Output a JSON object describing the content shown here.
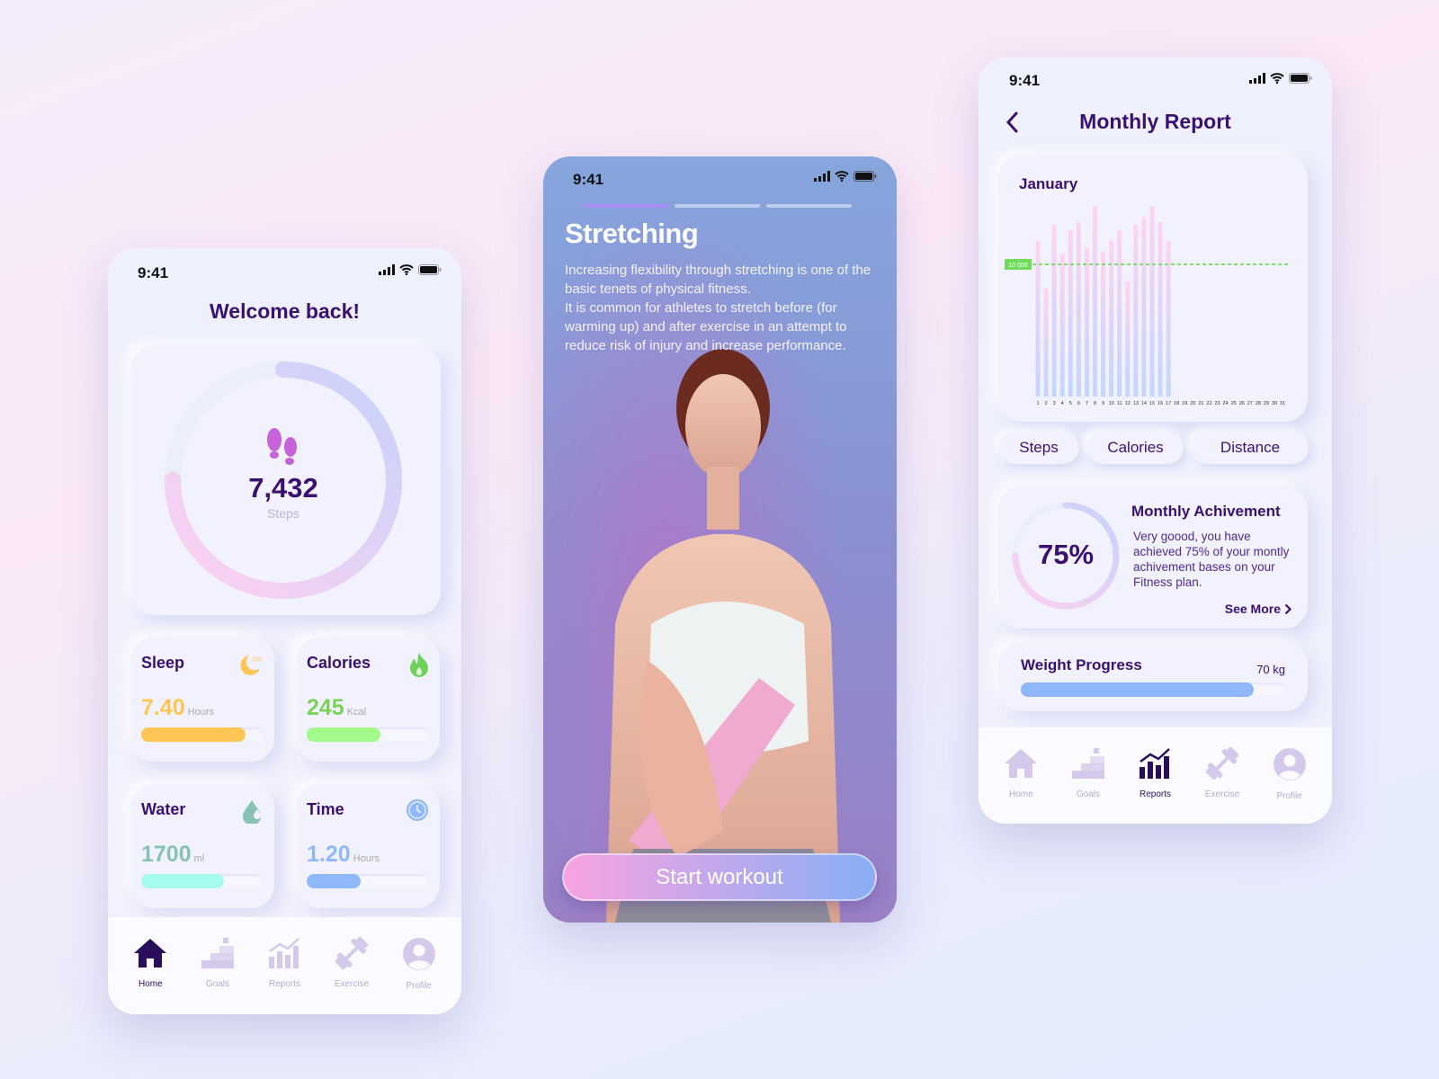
{
  "home": {
    "time": "9:41",
    "title": "Welcome back!",
    "steps": {
      "value": "7,432",
      "label": "Steps",
      "progress": 0.75
    },
    "tiles": [
      {
        "title": "Sleep",
        "value": "7.40",
        "unit": "Hours",
        "progress": 0.85,
        "color": "#ffc655",
        "icon": "moon-sleep-icon"
      },
      {
        "title": "Calories",
        "value": "245",
        "unit": "Kcal",
        "progress": 0.6,
        "color": "#a3f98a",
        "valueColor": "#7ad25a",
        "icon": "flame-icon"
      },
      {
        "title": "Water",
        "value": "1700",
        "unit": "ml",
        "progress": 0.68,
        "color": "#a6fbef",
        "valueColor": "#86c3b4",
        "icon": "water-drop-icon"
      },
      {
        "title": "Time",
        "value": "1.20",
        "unit": "Hours",
        "progress": 0.44,
        "color": "#8fb8fb",
        "valueColor": "#8fb8fb",
        "icon": "clock-icon"
      }
    ],
    "nav": [
      "Home",
      "Goals",
      "Reports",
      "Exercise",
      "Profile"
    ],
    "active_nav": "Home"
  },
  "workout": {
    "time": "9:41",
    "title": "Stretching",
    "steps_total": 3,
    "step_current": 1,
    "paragraphs": [
      "Increasing flexibility through stretching is one of the basic tenets of physical fitness.",
      "It is common for athletes to stretch before (for warming up) and after exercise in an attempt to reduce risk of injury and increase performance."
    ],
    "start_button": "Start workout"
  },
  "report": {
    "time": "9:41",
    "title": "Monthly Report",
    "tabs": [
      "Steps",
      "Calories",
      "Distance"
    ],
    "achievement": {
      "percent": "75%",
      "progress": 0.75,
      "title": "Monthly Achivement",
      "text": "Very goood, you have achieved 75% of your montly achivement bases on your Fitness plan.",
      "link": "See More"
    },
    "weight": {
      "title": "Weight Progress",
      "value": "70 kg",
      "progress": 0.88
    },
    "nav": [
      "Home",
      "Goals",
      "Reports",
      "Exercise",
      "Profile"
    ],
    "active_nav": "Reports"
  },
  "chart_data": {
    "type": "bar",
    "title": "January",
    "categories": [
      "1",
      "2",
      "3",
      "4",
      "5",
      "6",
      "7",
      "8",
      "9",
      "10",
      "11",
      "12",
      "13",
      "14",
      "15",
      "16",
      "17",
      "18",
      "19",
      "20",
      "21",
      "22",
      "23",
      "24",
      "25",
      "26",
      "27",
      "28",
      "29",
      "30",
      "31"
    ],
    "values": [
      11800,
      8200,
      13000,
      10800,
      12600,
      13200,
      11300,
      14400,
      11000,
      11800,
      12600,
      8700,
      13000,
      13600,
      14400,
      13200,
      11800,
      null,
      null,
      null,
      null,
      null,
      null,
      null,
      null,
      null,
      null,
      null,
      null,
      null,
      null
    ],
    "reference_line": {
      "value": 10000,
      "label": "10 000",
      "color": "#6fdc5a"
    },
    "ylim": [
      0,
      15000
    ],
    "grid": false,
    "bar_gradient": [
      "#ffd3f3",
      "#c3d6fd"
    ]
  }
}
